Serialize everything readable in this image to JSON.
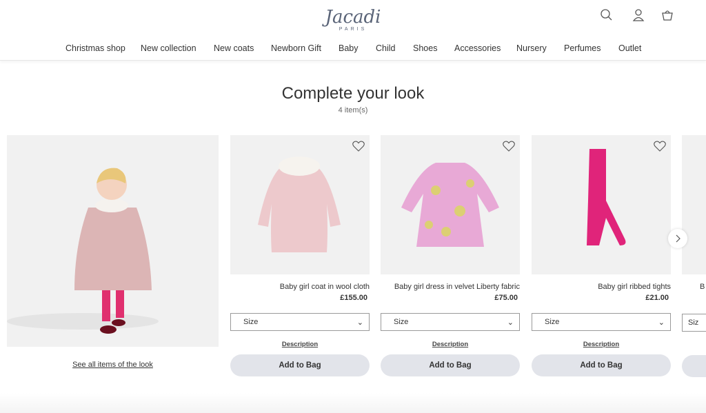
{
  "header": {
    "logo": "Jacadi",
    "logo_sub": "PARIS",
    "icons": [
      "search-icon",
      "account-icon",
      "bag-icon"
    ]
  },
  "nav": [
    "Christmas shop",
    "New collection",
    "New coats",
    "Newborn Gift",
    "Baby",
    "Child",
    "Shoes",
    "Accessories",
    "Nursery",
    "Perfumes",
    "Outlet"
  ],
  "section": {
    "title": "Complete your look",
    "count": "4 item(s)",
    "see_all": "See all items of the look"
  },
  "products": [
    {
      "name": "Baby girl coat in wool cloth",
      "price": "£155.00",
      "size": "Size",
      "description": "Description",
      "add": "Add to Bag"
    },
    {
      "name": "Baby girl dress in velvet Liberty fabric",
      "price": "£75.00",
      "size": "Size",
      "description": "Description",
      "add": "Add to Bag"
    },
    {
      "name": "Baby girl ribbed tights",
      "price": "£21.00",
      "size": "Size",
      "description": "Description",
      "add": "Add to Bag"
    },
    {
      "name": "B",
      "price": "",
      "size": "Siz",
      "description": "",
      "add": ""
    }
  ],
  "colors": {
    "button_bg": "#e2e4ea",
    "logo": "#5a6478",
    "image_bg": "#f1f1f1"
  }
}
